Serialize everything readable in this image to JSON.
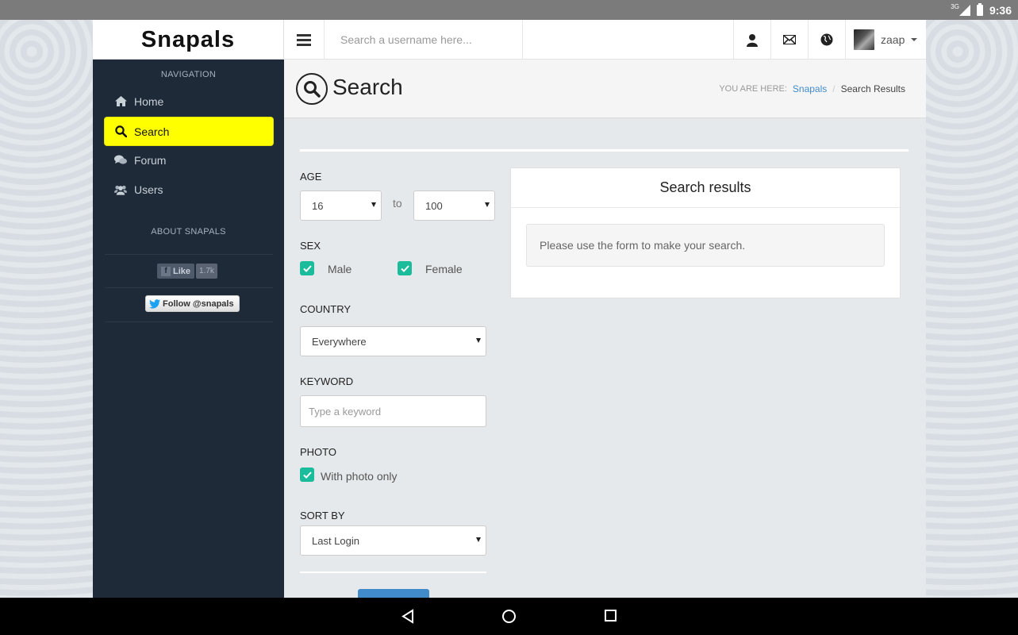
{
  "status_bar": {
    "network": "3G",
    "time": "9:36"
  },
  "topbar": {
    "brand": "Snapals",
    "search_placeholder": "Search a username here...",
    "username": "zaap"
  },
  "sidebar": {
    "nav_heading": "NAVIGATION",
    "items": [
      {
        "label": "Home",
        "icon": "home-icon"
      },
      {
        "label": "Search",
        "icon": "search-icon",
        "active": true
      },
      {
        "label": "Forum",
        "icon": "comments-icon"
      },
      {
        "label": "Users",
        "icon": "users-icon"
      }
    ],
    "about_heading": "ABOUT SNAPALS",
    "fb_like_label": "Like",
    "fb_like_count": "1.7k",
    "twitter_follow_label": "Follow @snapals"
  },
  "page_header": {
    "title": "Search",
    "breadcrumb_label": "YOU ARE HERE:",
    "breadcrumb_link": "Snapals",
    "breadcrumb_current": "Search Results"
  },
  "form": {
    "age_label": "AGE",
    "age_from": "16",
    "age_to_text": "to",
    "age_to": "100",
    "sex_label": "SEX",
    "sex_male_label": "Male",
    "sex_female_label": "Female",
    "country_label": "COUNTRY",
    "country_value": "Everywhere",
    "keyword_label": "KEYWORD",
    "keyword_placeholder": "Type a keyword",
    "photo_label": "PHOTO",
    "photo_only_label": "With photo only",
    "sortby_label": "SORT BY",
    "sortby_value": "Last Login"
  },
  "results": {
    "title": "Search results",
    "message": "Please use the form to make your search."
  },
  "colors": {
    "sidebar_bg": "#1e2a38",
    "active_nav": "#ffff00",
    "checkbox": "#1abc9c",
    "link": "#428bca",
    "button": "#428bca"
  }
}
